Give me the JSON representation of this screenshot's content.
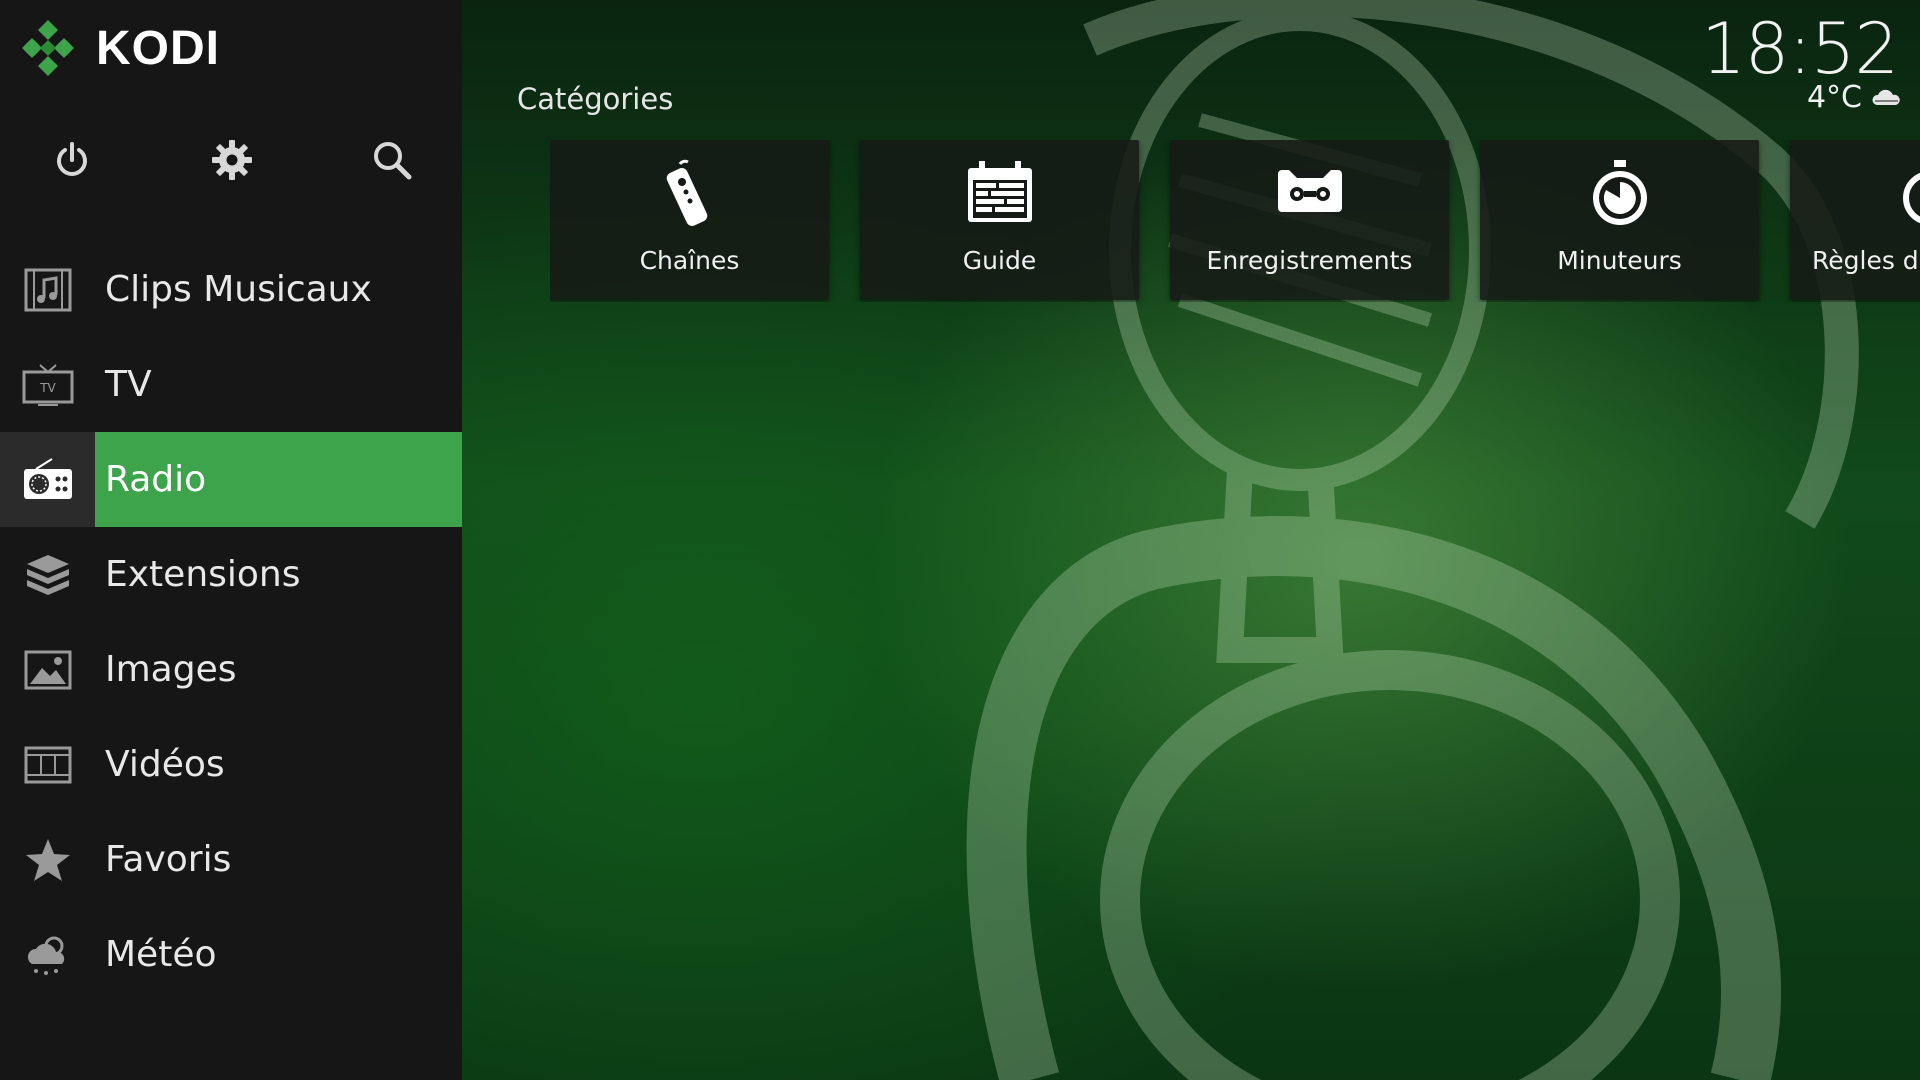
{
  "app": {
    "name": "KODI"
  },
  "top_actions": [
    {
      "name": "power-icon"
    },
    {
      "name": "settings-icon"
    },
    {
      "name": "search-icon"
    }
  ],
  "menu": {
    "items": [
      {
        "label": "Clips Musicaux",
        "icon": "music-video-icon"
      },
      {
        "label": "TV",
        "icon": "tv-icon"
      },
      {
        "label": "Radio",
        "icon": "radio-icon",
        "active": true
      },
      {
        "label": "Extensions",
        "icon": "addons-box-icon"
      },
      {
        "label": "Images",
        "icon": "pictures-icon"
      },
      {
        "label": "Vidéos",
        "icon": "film-strip-icon"
      },
      {
        "label": "Favoris",
        "icon": "star-icon"
      },
      {
        "label": "Météo",
        "icon": "weather-cloud-icon"
      }
    ],
    "active_color": "#3ea44b"
  },
  "main": {
    "section_title": "Catégories",
    "tiles": [
      {
        "label": "Chaînes",
        "icon": "remote-control-icon"
      },
      {
        "label": "Guide",
        "icon": "calendar-guide-icon"
      },
      {
        "label": "Enregistrements",
        "icon": "recording-tape-icon"
      },
      {
        "label": "Minuteurs",
        "icon": "stopwatch-icon"
      },
      {
        "label": "Règles de",
        "icon": "timer-rules-icon"
      }
    ]
  },
  "status": {
    "time": "18:52",
    "temperature": "4°C",
    "weather_icon": "cloud-icon"
  }
}
